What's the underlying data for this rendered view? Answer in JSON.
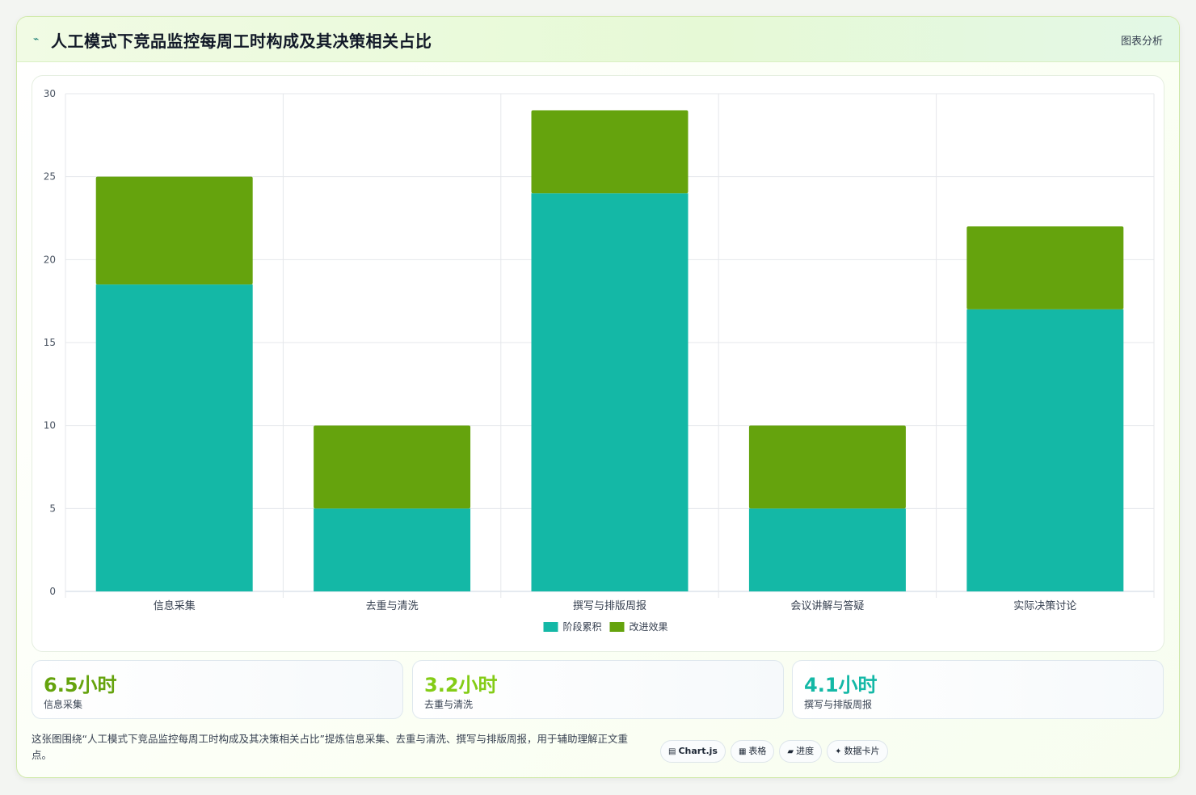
{
  "header": {
    "icon": "chart-line-icon",
    "title": "人工模式下竞品监控每周工时构成及其决策相关占比",
    "tag": "图表分析"
  },
  "chart_data": {
    "type": "bar",
    "stacked": true,
    "categories": [
      "信息采集",
      "去重与清洗",
      "撰写与排版周报",
      "会议讲解与答疑",
      "实际决策讨论"
    ],
    "series": [
      {
        "name": "阶段累积",
        "color": "#14b8a6",
        "values": [
          18.5,
          5,
          24,
          5,
          17
        ]
      },
      {
        "name": "改进效果",
        "color": "#65a30d",
        "values": [
          6.5,
          5,
          5,
          5,
          5
        ]
      }
    ],
    "ylim": [
      0,
      30
    ],
    "yticks": [
      0,
      5,
      10,
      15,
      20,
      25,
      30
    ],
    "grid": true,
    "legend": "bottom"
  },
  "kpis": [
    {
      "value": "6.5小时",
      "label": "信息采集",
      "color": "#65a30d"
    },
    {
      "value": "3.2小时",
      "label": "去重与清洗",
      "color": "#84cc16"
    },
    {
      "value": "4.1小时",
      "label": "撰写与排版周报",
      "color": "#14b8a6"
    }
  ],
  "caption": "这张图围绕“人工模式下竞品监控每周工时构成及其决策相关占比”提炼信息采集、去重与清洗、撰写与排版周报，用于辅助理解正文重点。",
  "chips": [
    {
      "icon": "chart-icon",
      "glyph": "▤",
      "label": "Chart.js"
    },
    {
      "icon": "table-icon",
      "glyph": "▦",
      "label": "表格"
    },
    {
      "icon": "progress-icon",
      "glyph": "▰",
      "label": "进度"
    },
    {
      "icon": "sparkle-icon",
      "glyph": "✦",
      "label": "数据卡片"
    }
  ]
}
